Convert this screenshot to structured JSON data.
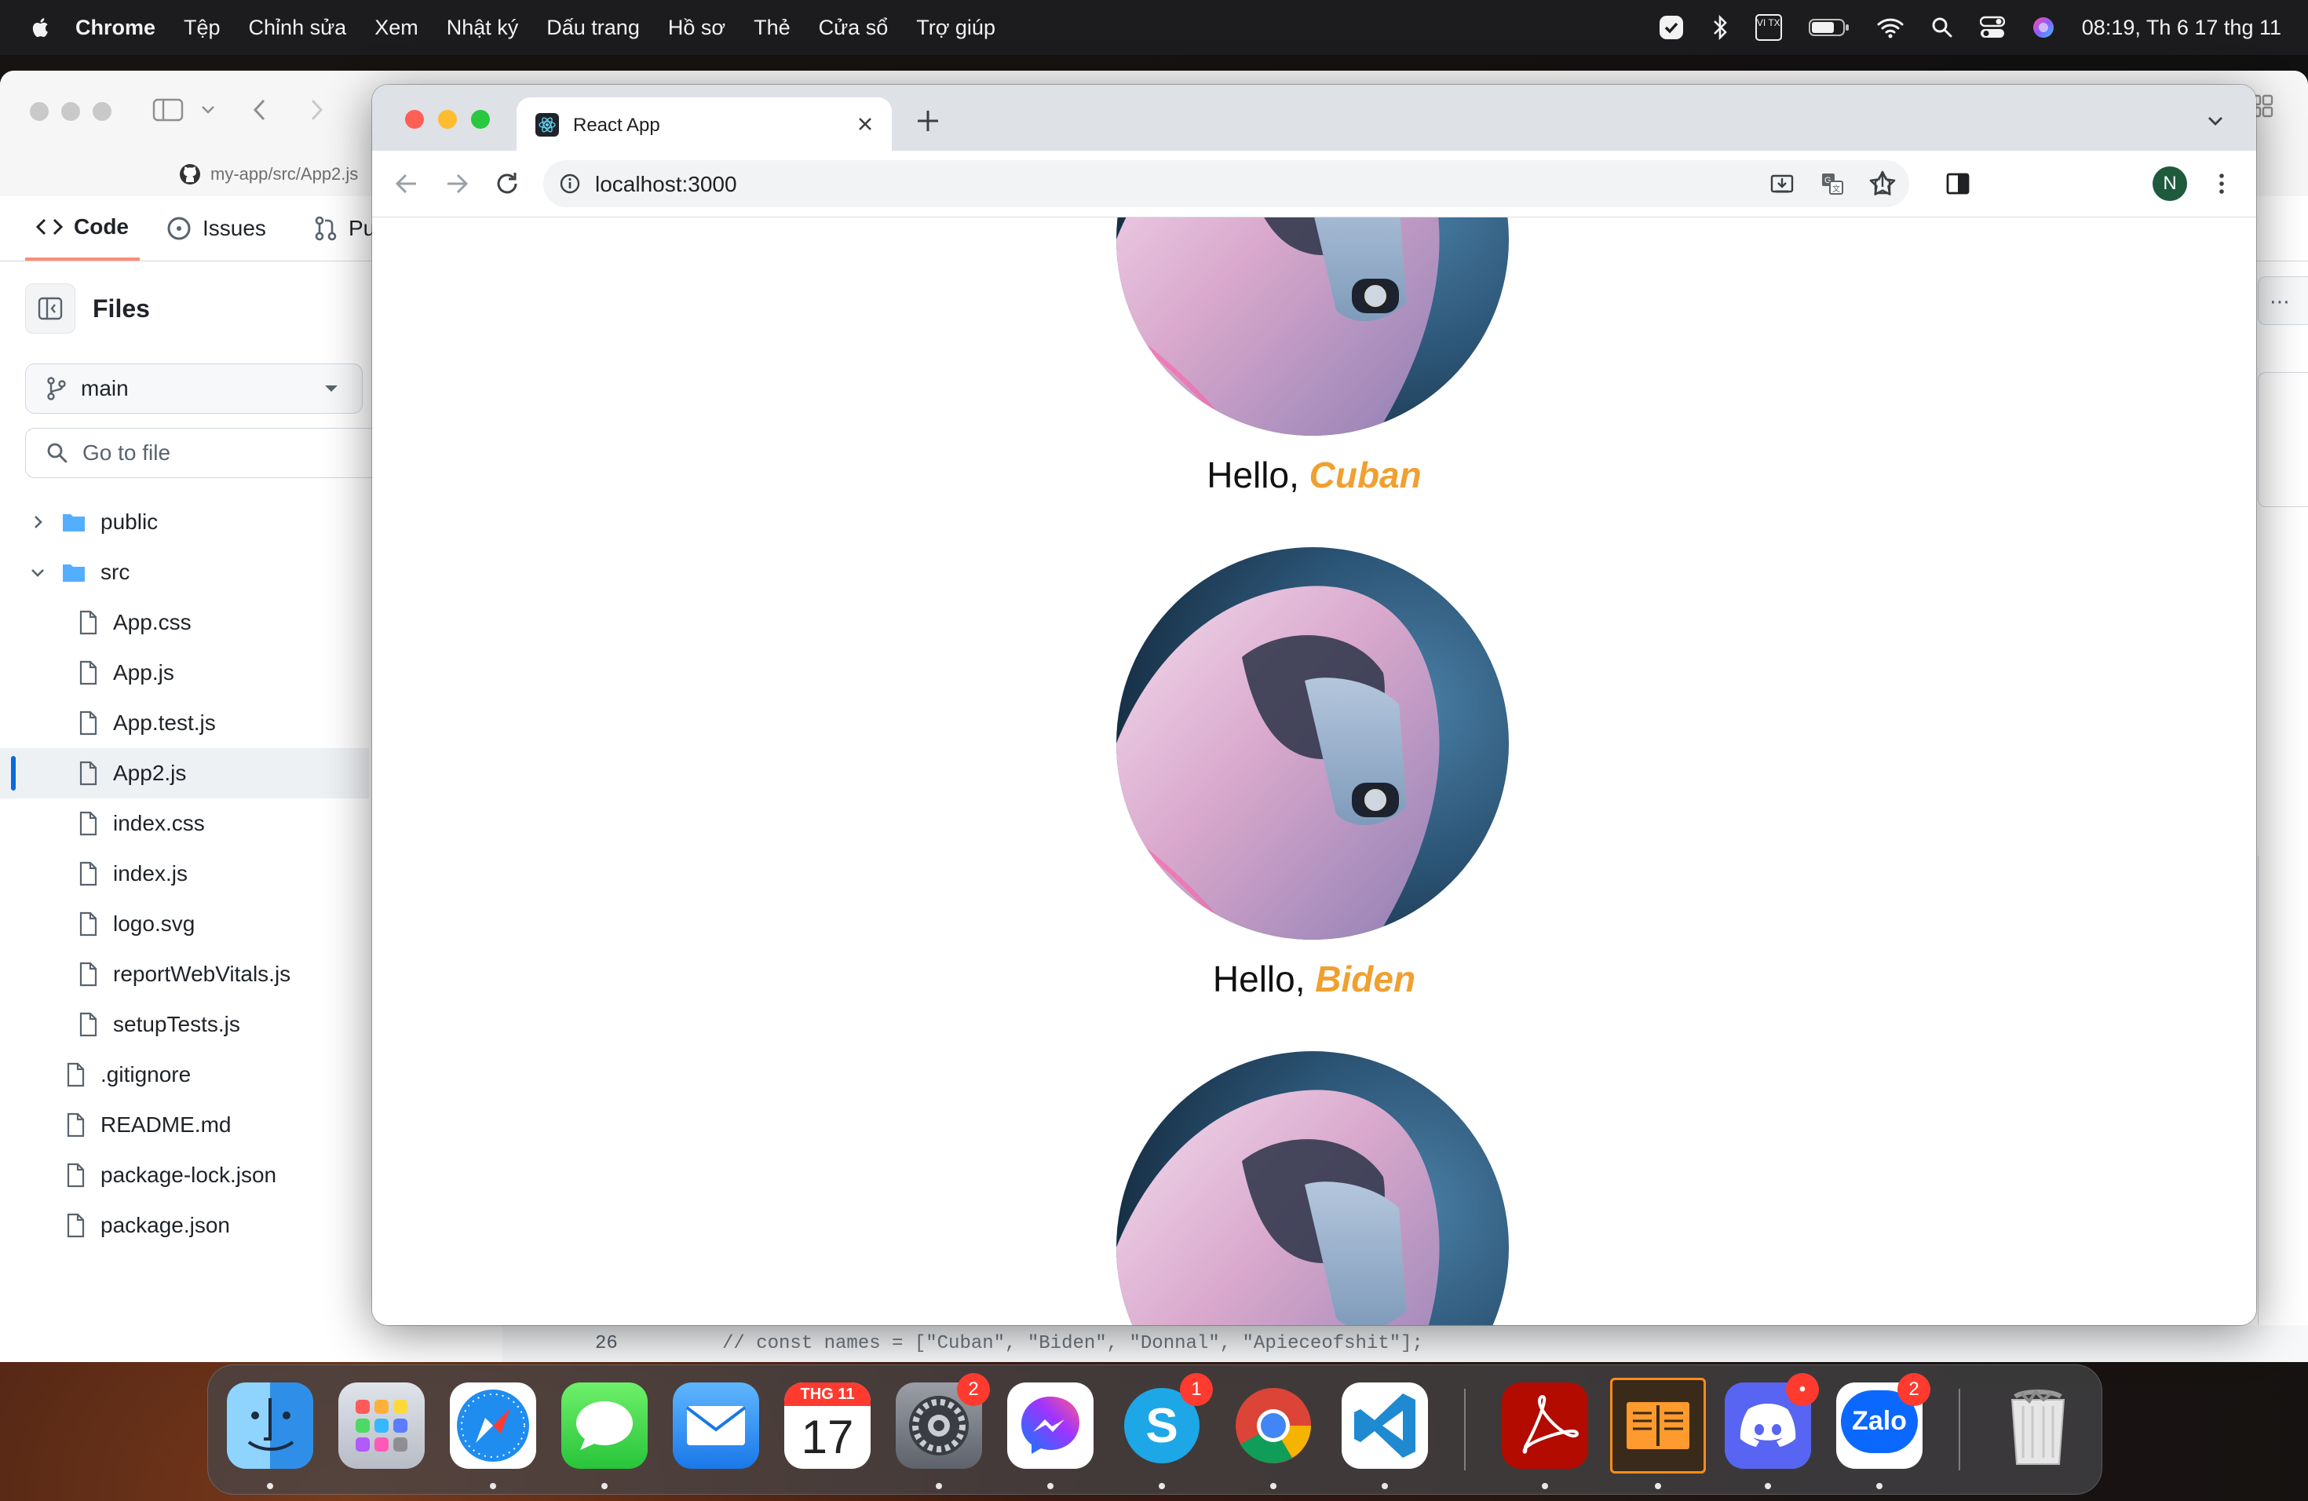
{
  "menubar": {
    "app_name": "Chrome",
    "items": [
      "Tệp",
      "Chỉnh sửa",
      "Xem",
      "Nhật ký",
      "Dấu trang",
      "Hồ sơ",
      "Thẻ",
      "Cửa sổ",
      "Trợ giúp"
    ],
    "keyboard_indicator": "VI TX",
    "clock": "08:19, Th 6 17 thg 11"
  },
  "github": {
    "tab_path": "my-app/src/App2.js",
    "tabs": [
      "Code",
      "Issues",
      "Pu"
    ],
    "files_title": "Files",
    "branch": "main",
    "go_to_file_placeholder": "Go to file",
    "tree": [
      {
        "label": "public",
        "type": "folder",
        "expanded": false
      },
      {
        "label": "src",
        "type": "folder",
        "expanded": true
      },
      {
        "label": "App.css",
        "type": "file",
        "depth": 1
      },
      {
        "label": "App.js",
        "type": "file",
        "depth": 1
      },
      {
        "label": "App.test.js",
        "type": "file",
        "depth": 1
      },
      {
        "label": "App2.js",
        "type": "file",
        "depth": 1,
        "selected": true
      },
      {
        "label": "index.css",
        "type": "file",
        "depth": 1
      },
      {
        "label": "index.js",
        "type": "file",
        "depth": 1
      },
      {
        "label": "logo.svg",
        "type": "file",
        "depth": 1
      },
      {
        "label": "reportWebVitals.js",
        "type": "file",
        "depth": 1
      },
      {
        "label": "setupTests.js",
        "type": "file",
        "depth": 1
      },
      {
        "label": ".gitignore",
        "type": "file",
        "depth": 0
      },
      {
        "label": "README.md",
        "type": "file",
        "depth": 0
      },
      {
        "label": "package-lock.json",
        "type": "file",
        "depth": 0
      },
      {
        "label": "package.json",
        "type": "file",
        "depth": 0
      }
    ],
    "code_line_number": "26",
    "code_line_text": "// const names = [\"Cuban\", \"Biden\", \"Donnal\", \"Apieceofshit\"];"
  },
  "chrome": {
    "tab_title": "React App",
    "url": "localhost:3000",
    "profile_initial": "N"
  },
  "page": {
    "greeting": "Hello,",
    "cards": [
      {
        "name": "Cuban"
      },
      {
        "name": "Biden"
      },
      {
        "name": ""
      }
    ]
  },
  "dock": {
    "apps": [
      {
        "name": "Finder",
        "icon": "finder-icon"
      },
      {
        "name": "Launchpad",
        "icon": "launchpad-icon"
      },
      {
        "name": "Safari",
        "icon": "safari-icon"
      },
      {
        "name": "Messages",
        "icon": "messages-icon"
      },
      {
        "name": "Mail",
        "icon": "mail-icon"
      },
      {
        "name": "Calendar",
        "icon": "calendar-icon",
        "month": "THG 11",
        "day": "17"
      },
      {
        "name": "System Settings",
        "icon": "settings-icon",
        "badge": "2"
      },
      {
        "name": "Messenger",
        "icon": "messenger-icon"
      },
      {
        "name": "Skype",
        "icon": "skype-icon",
        "badge": "1"
      },
      {
        "name": "Chrome",
        "icon": "chrome-icon"
      },
      {
        "name": "VS Code",
        "icon": "vscode-icon"
      },
      {
        "name": "Acrobat",
        "icon": "acrobat-icon"
      },
      {
        "name": "Books",
        "icon": "books-icon"
      },
      {
        "name": "Discord",
        "icon": "discord-icon",
        "badge": "•"
      },
      {
        "name": "Zalo",
        "icon": "zalo-icon",
        "badge": "2",
        "label": "Zalo"
      },
      {
        "name": "Trash",
        "icon": "trash-icon"
      }
    ]
  },
  "colors": {
    "accent_name": "#f0a030",
    "github_tab_underline": "#fd8c73",
    "selected_file_bar": "#0969da",
    "badge": "#ff3b30"
  }
}
